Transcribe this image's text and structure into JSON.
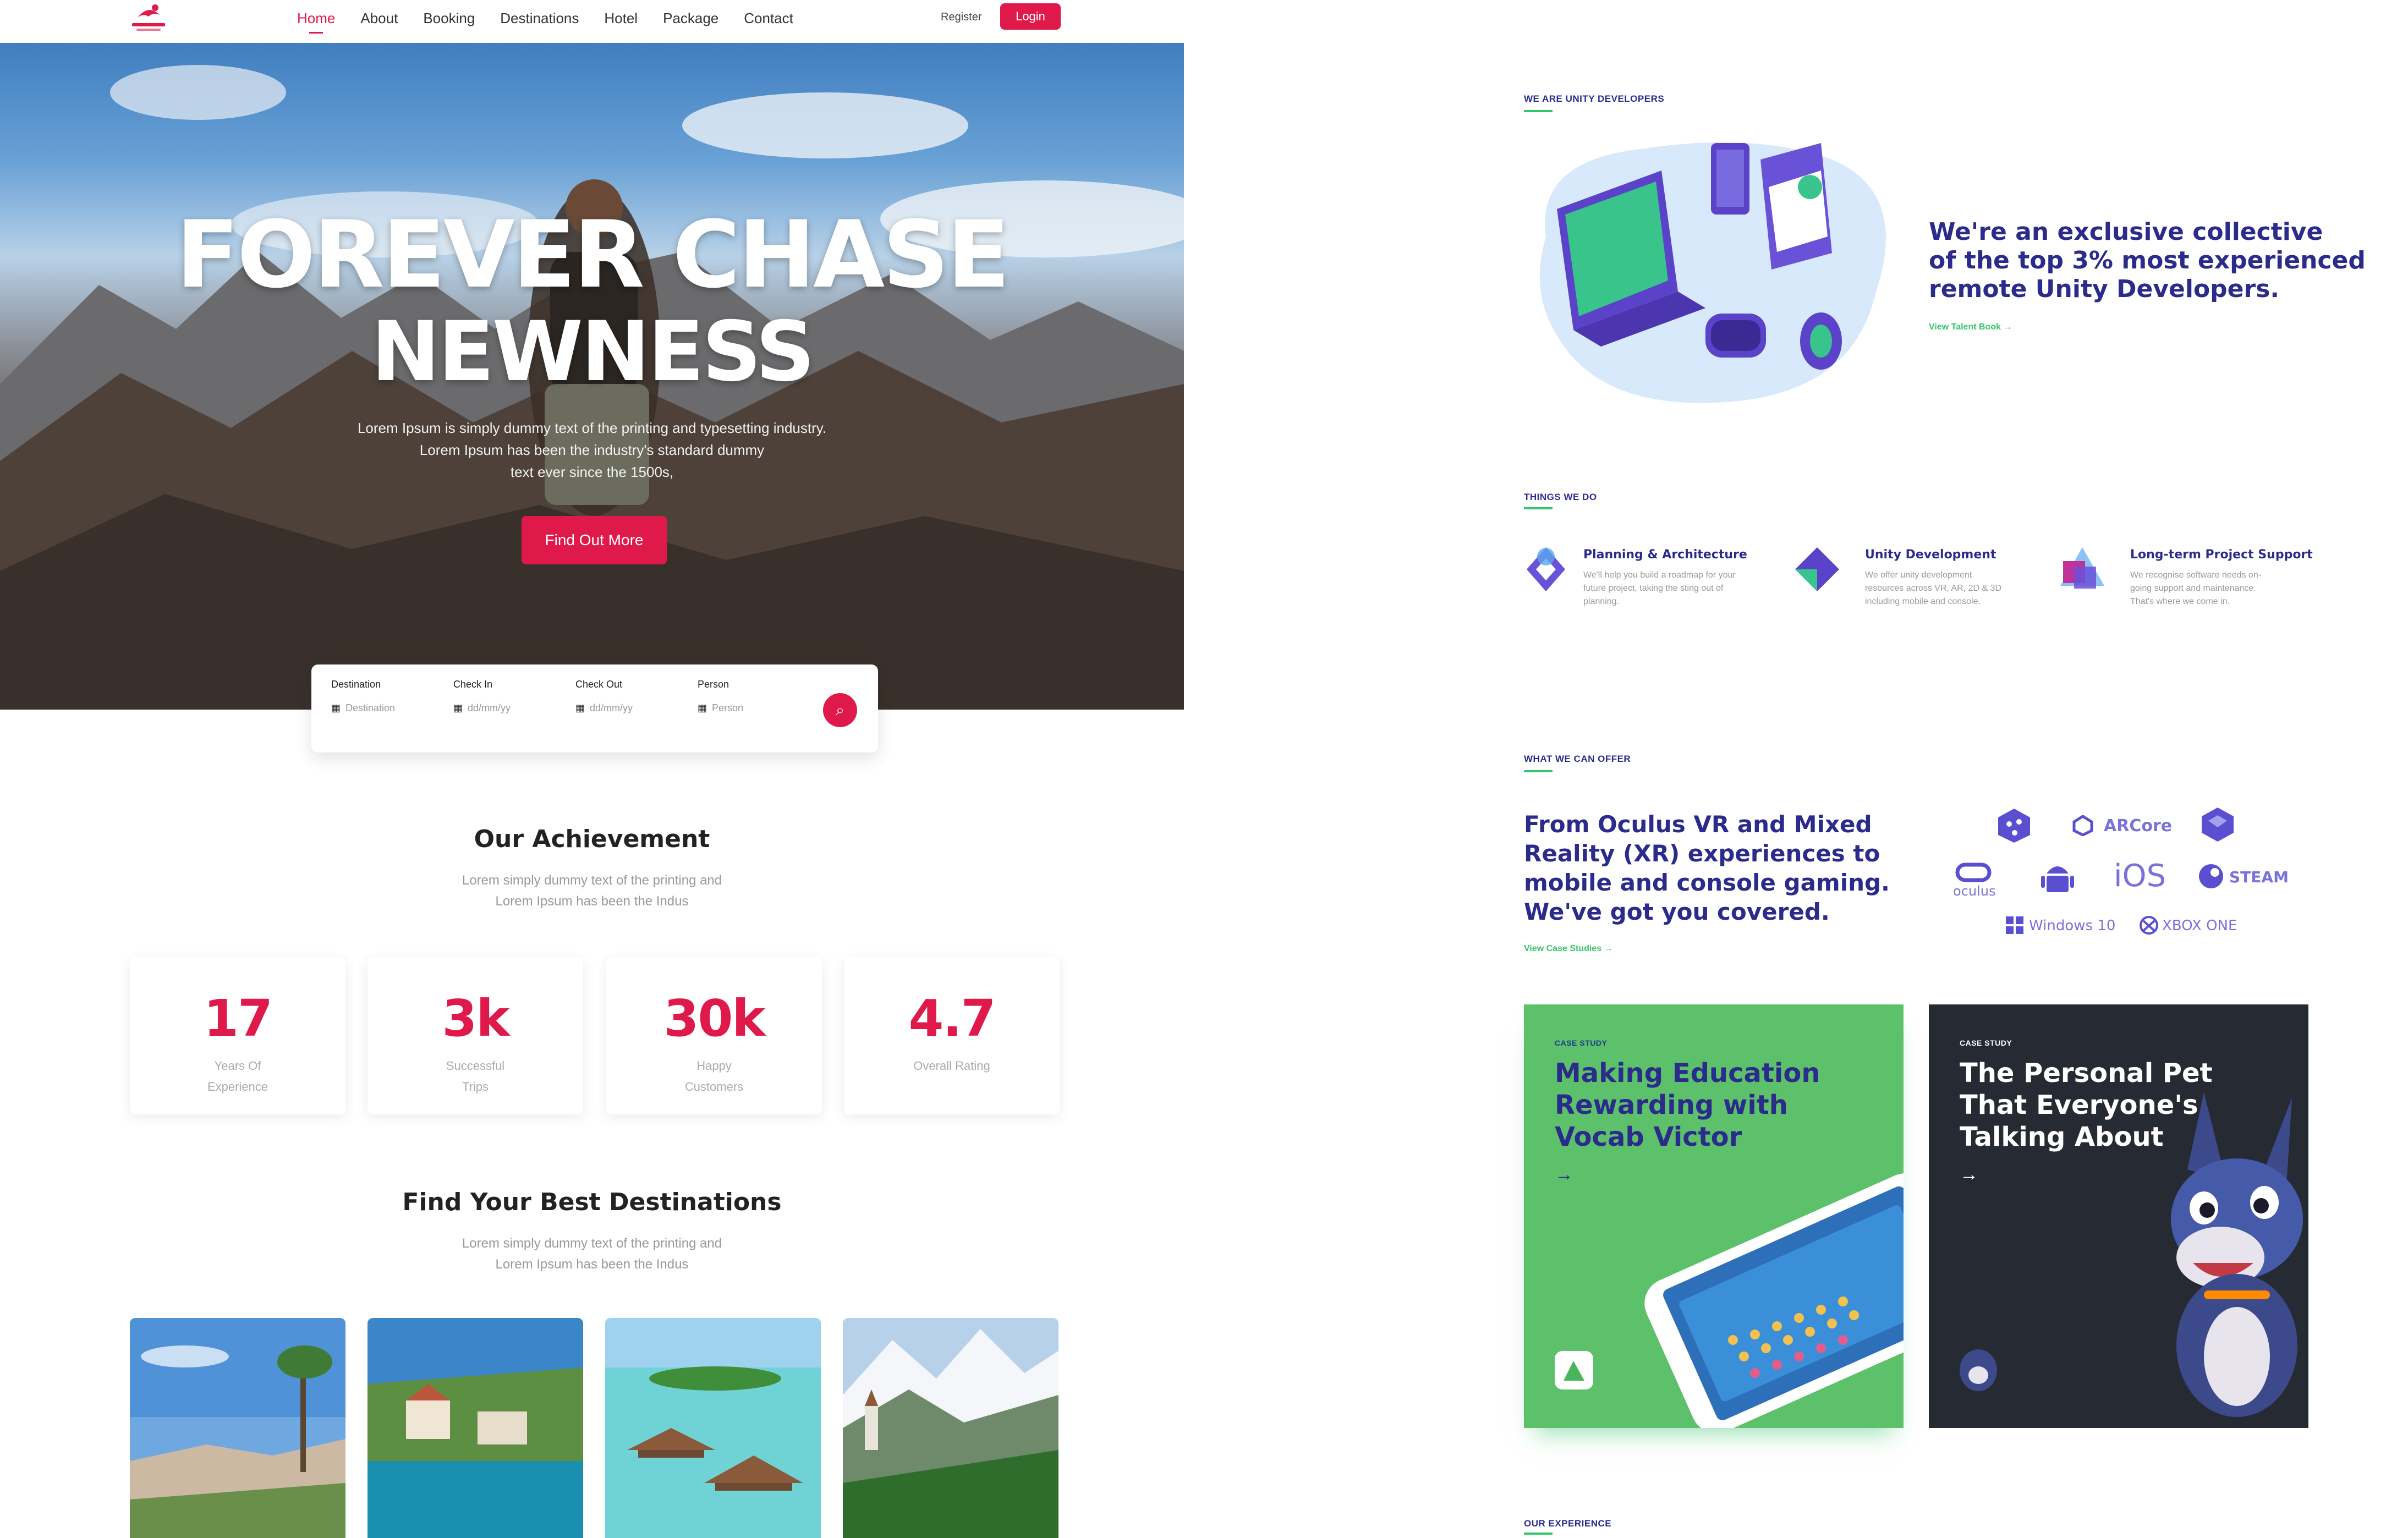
{
  "travel": {
    "nav": {
      "items": [
        "Home",
        "About",
        "Booking",
        "Destinations",
        "Hotel",
        "Package",
        "Contact"
      ],
      "register": "Register",
      "login": "Login"
    },
    "hero": {
      "title_line1": "FOREVER CHASE",
      "title_line2": "NEWNESS",
      "subtitle_line1": "Lorem Ipsum is simply dummy text of the printing and typesetting industry.",
      "subtitle_line2": "Lorem Ipsum has been the industry's standard dummy",
      "subtitle_line3": "text ever since the 1500s,",
      "cta": "Find Out More"
    },
    "search": {
      "fields": [
        {
          "label": "Destination",
          "placeholder": "Destination",
          "icon": "location-icon"
        },
        {
          "label": "Check In",
          "placeholder": "dd/mm/yy",
          "icon": "calendar-icon"
        },
        {
          "label": "Check Out",
          "placeholder": "dd/mm/yy",
          "icon": "calendar-icon"
        },
        {
          "label": "Person",
          "placeholder": "Person",
          "icon": "person-icon"
        }
      ],
      "button_icon": "search-icon"
    },
    "achievement": {
      "title": "Our Achievement",
      "text_line1": "Lorem simply dummy text of the printing and",
      "text_line2": "Lorem Ipsum has been the Indus",
      "stats": [
        {
          "value": "17",
          "label": "Years Of Experience"
        },
        {
          "value": "3k",
          "label": "Successful Trips"
        },
        {
          "value": "30k",
          "label": "Happy Customers"
        },
        {
          "value": "4.7",
          "label": "Overall Rating"
        }
      ]
    },
    "destinations": {
      "title": "Find Your Best Destinations",
      "text_line1": "Lorem simply dummy text of the printing and",
      "text_line2": "Lorem Ipsum has been the Indus"
    },
    "colors": {
      "accent": "#e0194b"
    }
  },
  "unity": {
    "section1": "WE ARE UNITY DEVELOPERS",
    "intro_line1": "We're an exclusive collective",
    "intro_line2": "of the top 3% most experienced",
    "intro_line3": "remote Unity Developers.",
    "intro_link": "View Talent Book →",
    "section2": "THINGS WE DO",
    "services": [
      {
        "title": "Planning & Architecture",
        "line1": "We'll help you build a roadmap for your",
        "line2": "future project, taking the sting out of",
        "line3": "planning."
      },
      {
        "title": "Unity Development",
        "line1": "We offer unity development",
        "line2": "resources across VR, AR, 2D & 3D",
        "line3": "including mobile and console."
      },
      {
        "title": "Long-term Project Support",
        "line1": "We recognise software needs on-",
        "line2": "going support and maintenance.",
        "line3": "That's where we come in."
      }
    ],
    "section3": "WHAT WE CAN OFFER",
    "offer_line1": "From Oculus VR and Mixed",
    "offer_line2": "Reality (XR) experiences to",
    "offer_line3": "mobile and console gaming.",
    "offer_line4": "We've got you covered.",
    "offer_link": "View Case Studies →",
    "platforms": {
      "arcore": "ARCore",
      "steam": "STEAM",
      "oculus": "oculus",
      "ios": "iOS",
      "windows": "Windows 10",
      "xbox": "XBOX ONE"
    },
    "cases": [
      {
        "tag": "CASE STUDY",
        "title_line1": "Making Education",
        "title_line2": "Rewarding with",
        "title_line3": "Vocab Victor",
        "arrow": "→"
      },
      {
        "tag": "CASE STUDY",
        "title_line1": "The Personal Pet",
        "title_line2": "That Everyone's",
        "title_line3": "Talking About",
        "arrow": "→"
      }
    ],
    "section4": "OUR EXPERIENCE",
    "colors": {
      "primary": "#2b2b8c",
      "green": "#35c56b",
      "case1_bg": "#5cc16a",
      "case2_bg": "#262b33"
    }
  }
}
